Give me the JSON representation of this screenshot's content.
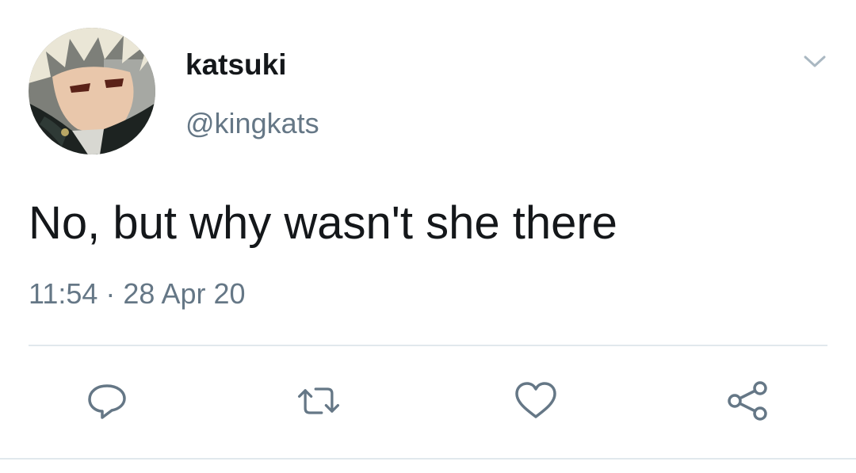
{
  "author": {
    "display_name": "katsuki",
    "handle": "@kingkats"
  },
  "tweet": {
    "text": "No, but why wasn't she there",
    "timestamp": "11:54 · 28 Apr 20"
  },
  "actions": {
    "reply_icon": "reply-icon",
    "retweet_icon": "retweet-icon",
    "like_icon": "heart-icon",
    "share_icon": "share-icon",
    "more_icon": "chevron-down-icon"
  },
  "colors": {
    "primary_text": "#14171a",
    "secondary_text": "#657786",
    "icon": "#657786",
    "divider": "#e1e8ed"
  }
}
